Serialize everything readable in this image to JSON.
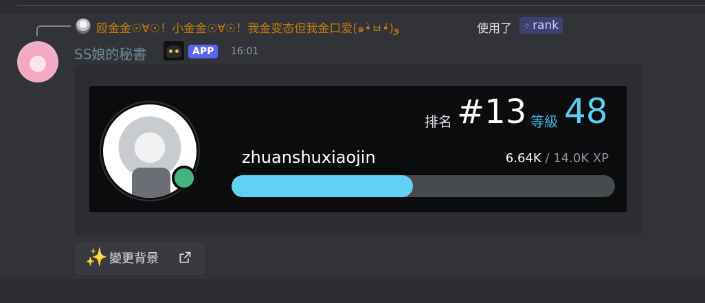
{
  "reply": {
    "author": "殴金金☉∀☉！小金金☉∀☉！我金变态但我金口爱(๑•̀ㅂ•́)و",
    "used_text": "使用了",
    "command": "rank"
  },
  "message": {
    "username": "SS娘的秘書",
    "badge": "APP",
    "timestamp": "16:01"
  },
  "rank_card": {
    "rank_label": "排名",
    "rank_value": "#13",
    "level_label": "等級",
    "level_value": "48",
    "username": "zhuanshuxiaojin",
    "xp_current": "6.64K",
    "xp_separator": "/",
    "xp_max": "14.0K XP",
    "progress_fraction": 0.474,
    "status_color": "#43b581",
    "accent_color": "#62d2f4"
  },
  "actions": {
    "change_background": "變更背景",
    "sparkle_icon": "sparkles-icon",
    "external_icon": "external-link-icon"
  }
}
